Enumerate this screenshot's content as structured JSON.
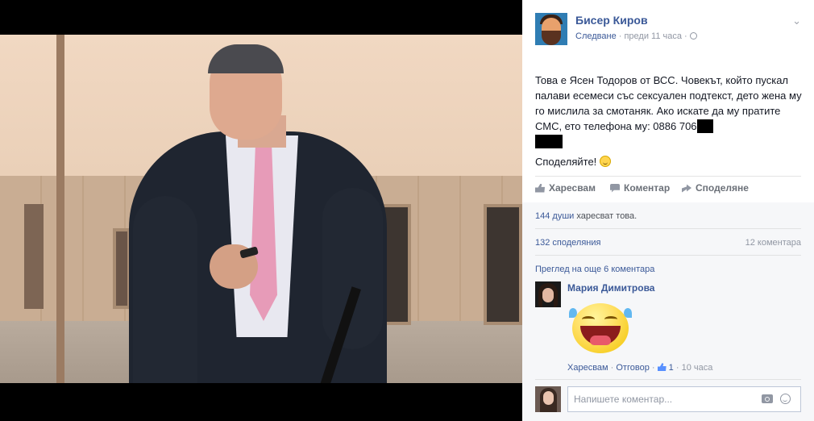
{
  "post": {
    "author": "Бисер Киров",
    "follow": "Следване",
    "separator": " · ",
    "time": "преди 11 часа",
    "text_line1": "Това е Ясен Тодоров от ВСС. Човекът, който пускал палави есемеси със сексуален подтекст, дето жена му го мислила за смотаняк. Ако искате да му пратите СМС, ето телефона му: 0886 706",
    "text_line2": "Споделяйте!"
  },
  "actions": {
    "like": "Харесвам",
    "comment": "Коментар",
    "share": "Споделяне"
  },
  "ufi": {
    "likes_link": "144 души",
    "likes_text": " харесват това.",
    "shares": "132 споделяния",
    "comments_count": "12 коментара",
    "view_more": "Преглед на още 6 коментара"
  },
  "comment": {
    "author": "Мария Димитрова",
    "like": "Харесвам",
    "reply": "Отговор",
    "likes": "1",
    "time": "10 часа"
  },
  "composer": {
    "placeholder": "Напишете коментар..."
  }
}
